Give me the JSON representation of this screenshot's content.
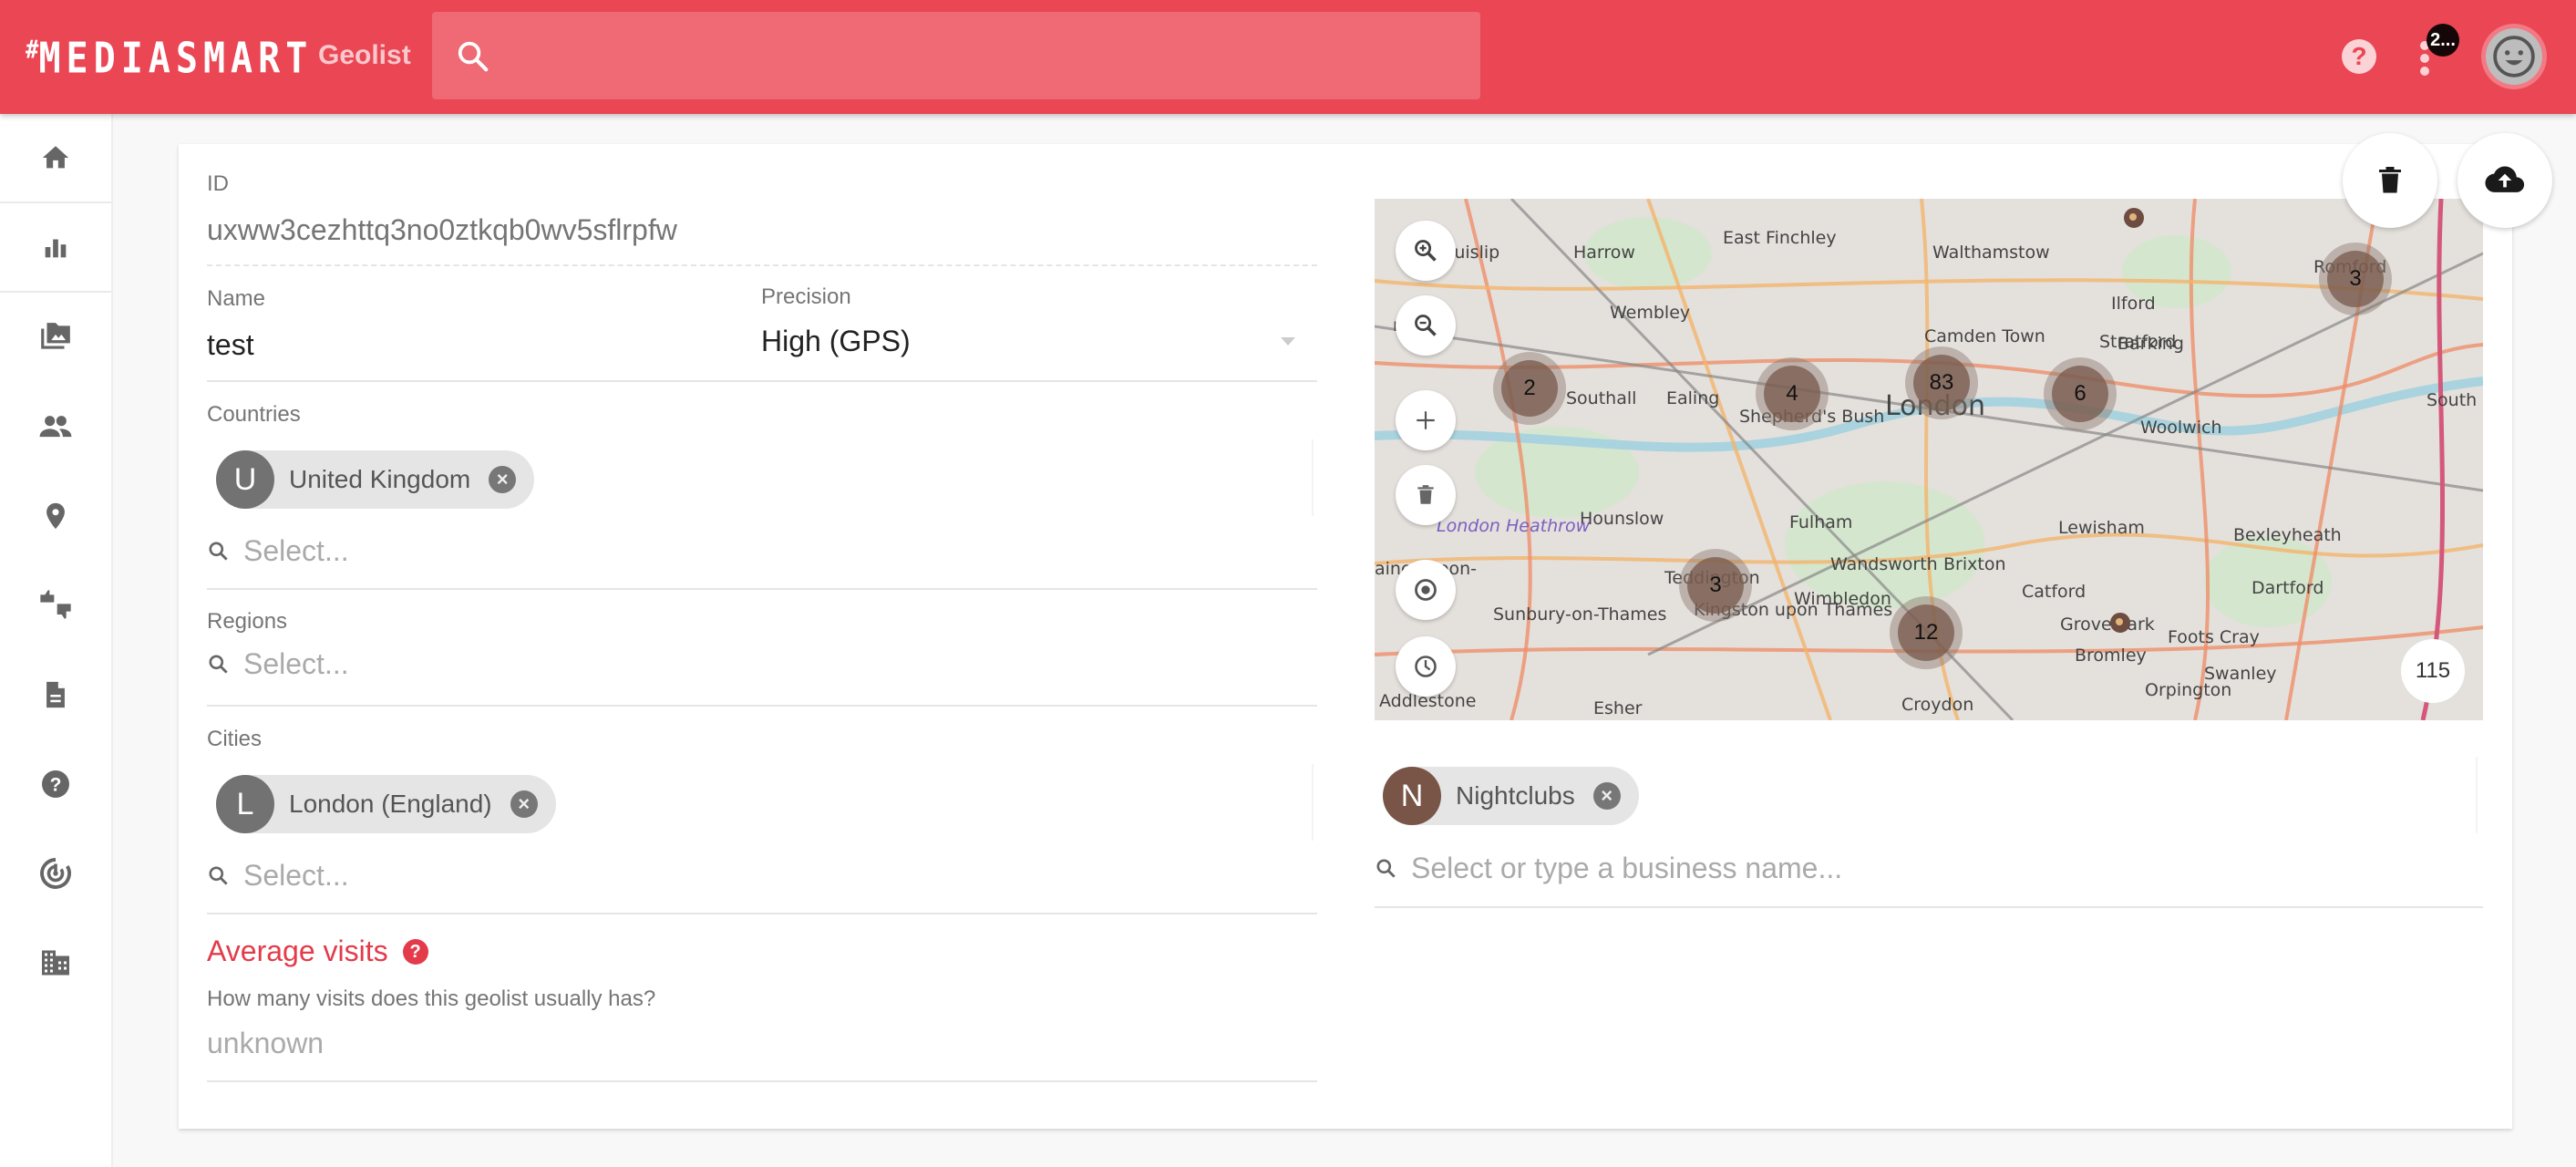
{
  "header": {
    "logo": "MEDIASMART",
    "logo_prefix": "#",
    "section_title": "Geolist",
    "search_placeholder": "",
    "notification_badge": "2...",
    "help_icon_glyph": "?"
  },
  "sidebar": {
    "items": [
      {
        "name": "home",
        "icon": "home-icon"
      },
      {
        "name": "analytics",
        "icon": "bar-chart-icon"
      },
      {
        "name": "creatives",
        "icon": "photo-library-icon"
      },
      {
        "name": "audiences",
        "icon": "people-icon"
      },
      {
        "name": "geolists",
        "icon": "location-pin-icon"
      },
      {
        "name": "ratings",
        "icon": "thumbs-up-down-icon"
      },
      {
        "name": "reports",
        "icon": "document-icon"
      },
      {
        "name": "help",
        "icon": "help-circle-icon"
      },
      {
        "name": "tracking",
        "icon": "radar-icon"
      },
      {
        "name": "organization",
        "icon": "building-icon"
      }
    ]
  },
  "form": {
    "id": {
      "label": "ID",
      "value": "uxww3cezhttq3no0ztkqb0wv5sflrpfw"
    },
    "name": {
      "label": "Name",
      "value": "test"
    },
    "precision": {
      "label": "Precision",
      "value": "High (GPS)"
    },
    "countries": {
      "label": "Countries",
      "chips": [
        {
          "initial": "U",
          "label": "United Kingdom"
        }
      ],
      "placeholder": "Select..."
    },
    "regions": {
      "label": "Regions",
      "placeholder": "Select..."
    },
    "cities": {
      "label": "Cities",
      "chips": [
        {
          "initial": "L",
          "label": "London (England)"
        }
      ],
      "placeholder": "Select..."
    },
    "average_visits": {
      "title": "Average visits",
      "help_glyph": "?",
      "question": "How many visits does this geolist usually has?",
      "value": "unknown"
    }
  },
  "map": {
    "controls": [
      "zoom-in",
      "zoom-out",
      "add",
      "delete",
      "locate",
      "history"
    ],
    "clusters": [
      {
        "count": "2"
      },
      {
        "count": "4"
      },
      {
        "count": "83"
      },
      {
        "count": "6"
      },
      {
        "count": "3"
      },
      {
        "count": "3"
      },
      {
        "count": "12"
      }
    ],
    "total_count": "115",
    "place_labels": [
      "Ruislip",
      "Harrow",
      "East Finchley",
      "Walthamstow",
      "Wembley",
      "Camden Town",
      "Stratford",
      "Ilford",
      "Barking",
      "Romford",
      "Southall",
      "Ealing",
      "Shepherd's Bush",
      "London",
      "Woolwich",
      "South Ock",
      "Hounslow",
      "Fulham",
      "Lewisham",
      "Bexleyheath",
      "London Heathrow",
      "Wandsworth",
      "Brixton",
      "Catford",
      "Dartford",
      "Teddington",
      "Wimbledon",
      "Grove Park",
      "Foots Cray",
      "Sunbury-on-Thames",
      "Kingston upon Thames",
      "Bromley",
      "Swanley",
      "Orpington",
      "Addlestone",
      "Esher",
      "Croydon",
      "ridge",
      "aines-upon-"
    ]
  },
  "business": {
    "chips": [
      {
        "initial": "N",
        "label": "Nightclubs",
        "color": "#795548"
      }
    ],
    "placeholder": "Select or type a business name..."
  },
  "actions": {
    "delete": "delete",
    "upload": "upload"
  },
  "colors": {
    "brand": "#ea4654",
    "accent_red": "#e33b4a",
    "chip_bg": "#e5e5e5"
  }
}
